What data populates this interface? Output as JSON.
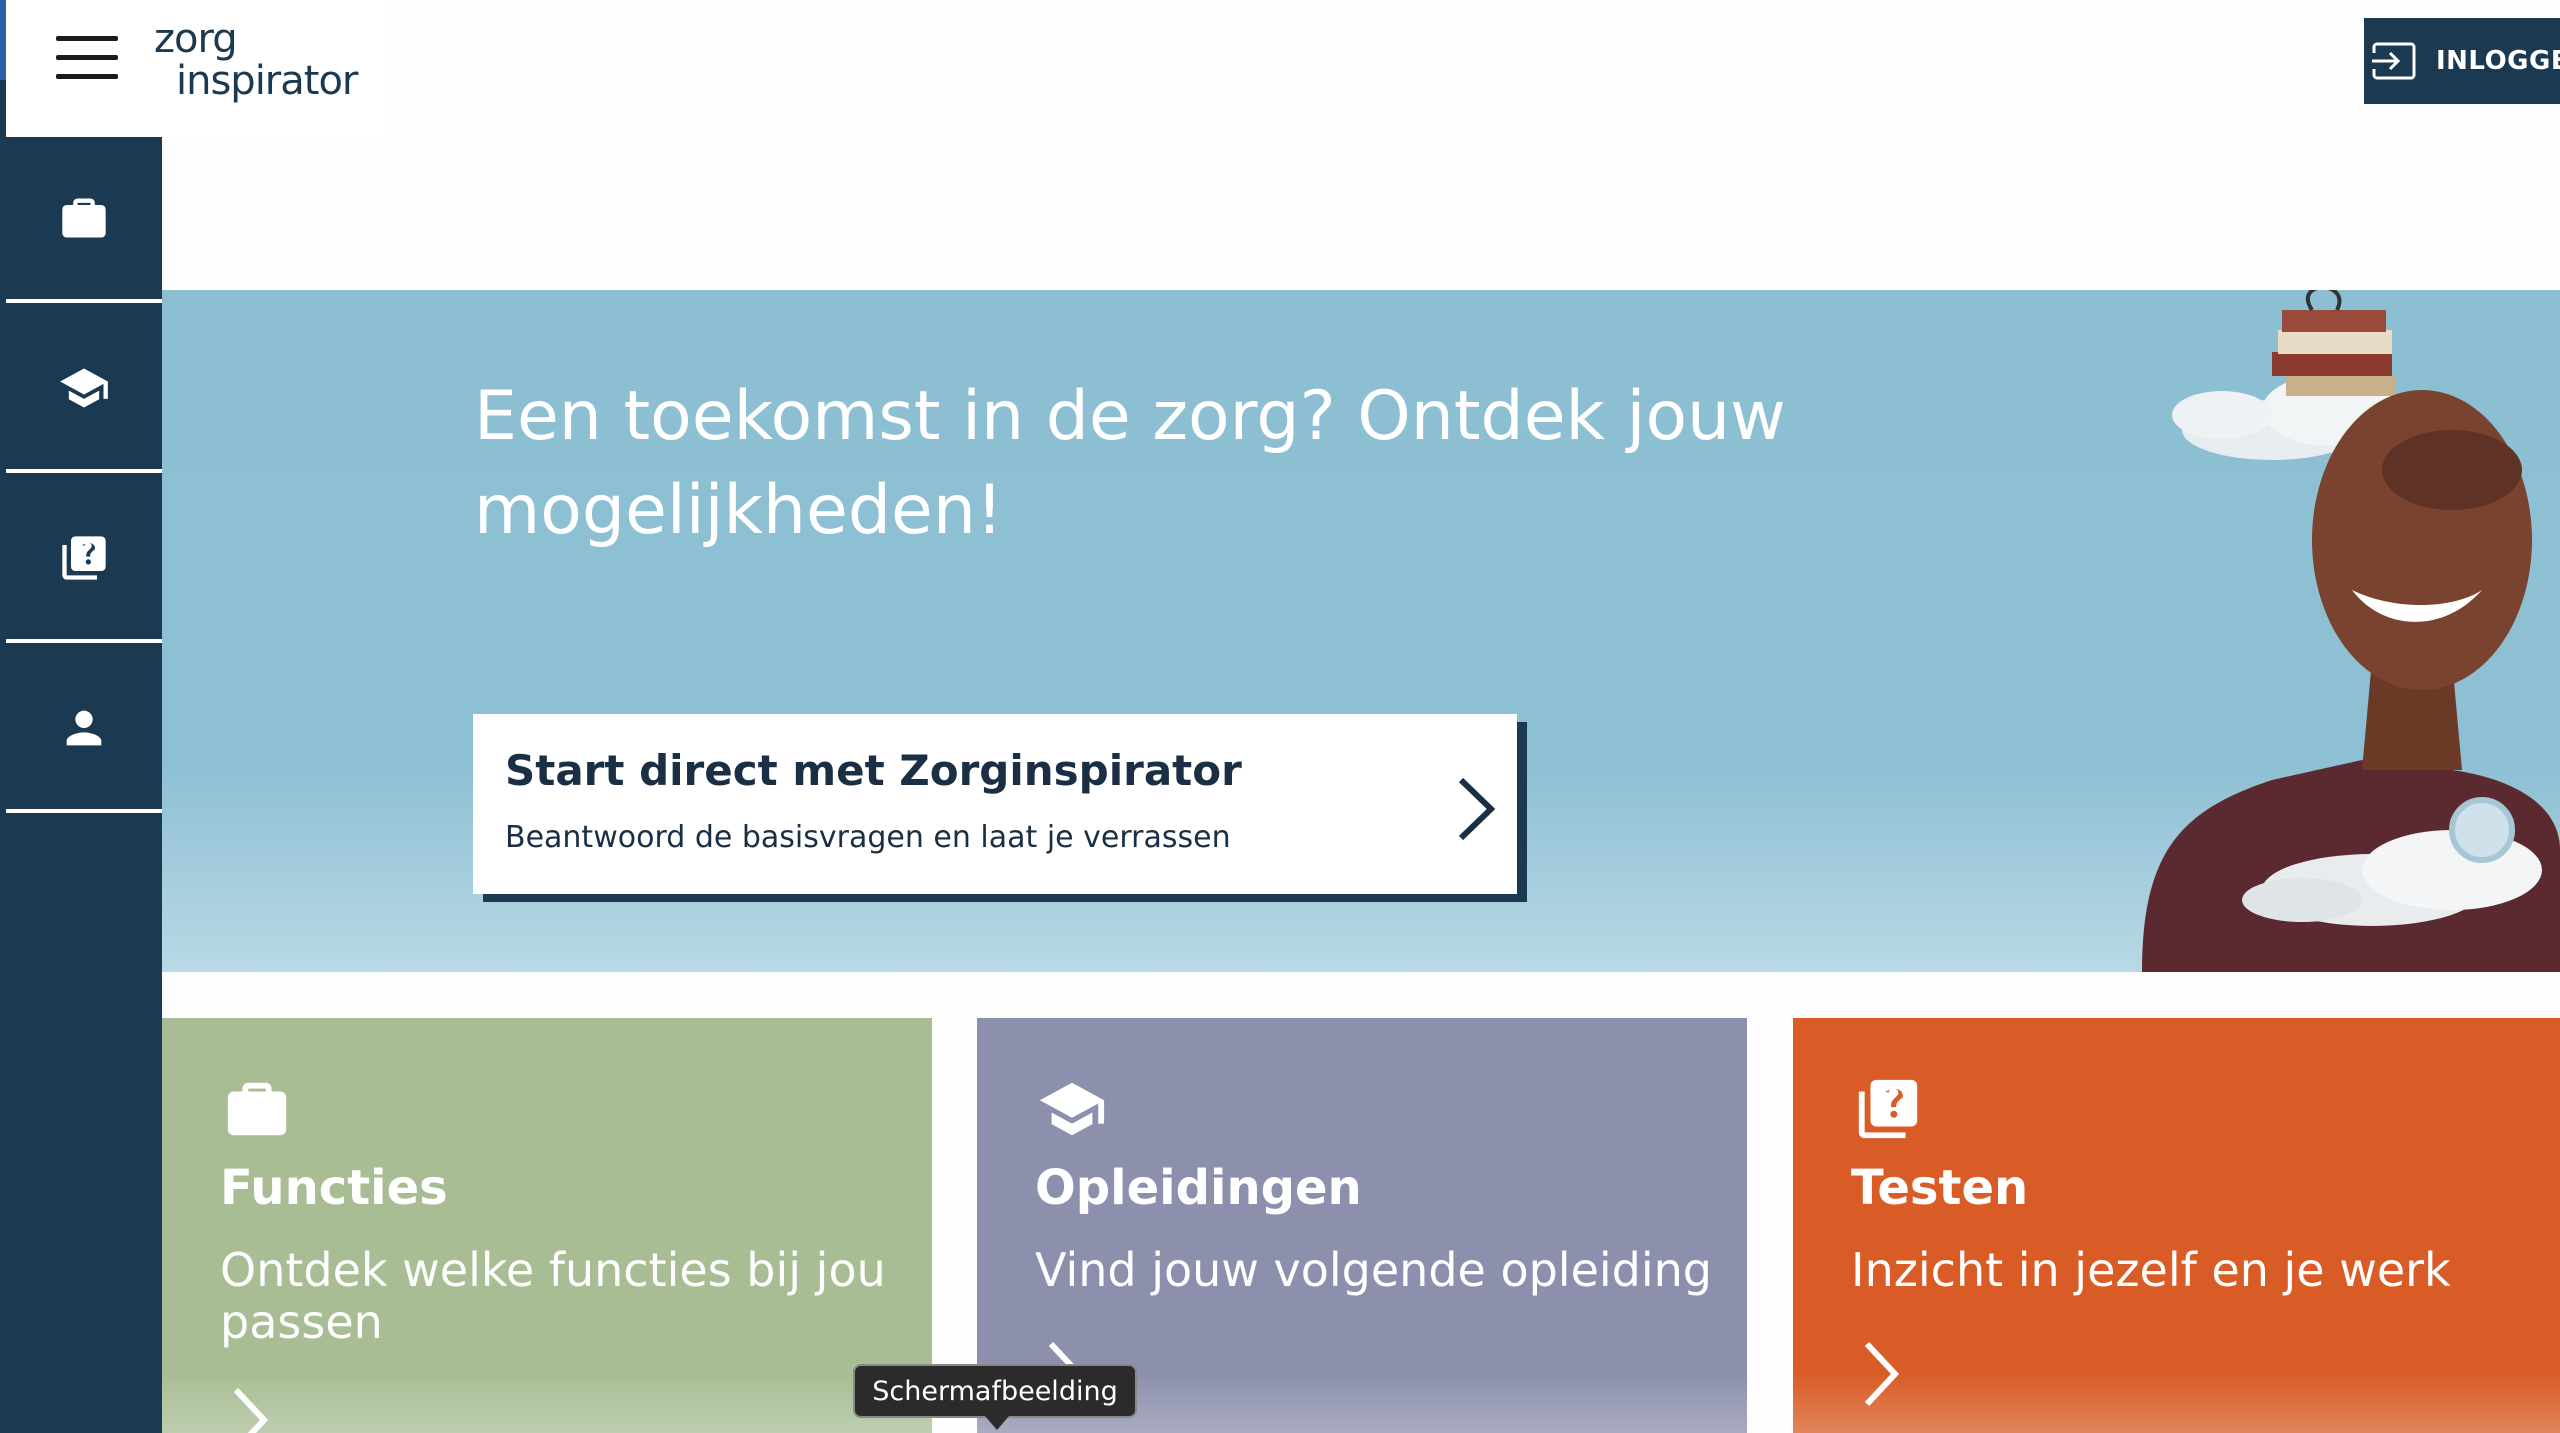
{
  "header": {
    "logo_line1": "zorg",
    "logo_line2": "inspirator",
    "login_label": "INLOGGEN"
  },
  "sidebar": {
    "items": [
      {
        "icon": "briefcase-icon"
      },
      {
        "icon": "graduation-cap-icon"
      },
      {
        "icon": "quiz-icon"
      },
      {
        "icon": "person-icon"
      }
    ]
  },
  "hero": {
    "title": "Een toekomst in de zorg? Ontdek jouw mogelijkheden!",
    "cta_title": "Start direct met Zorginspirator",
    "cta_subtitle": "Beantwoord de basisvragen en laat je verrassen"
  },
  "cards": [
    {
      "title": "Functies",
      "subtitle": "Ontdek welke functies bij jou passen",
      "color": "#a8bd94",
      "icon": "briefcase-icon"
    },
    {
      "title": "Opleidingen",
      "subtitle": "Vind jouw volgende opleiding",
      "color": "#8c90ad",
      "icon": "graduation-cap-icon"
    },
    {
      "title": "Testen",
      "subtitle": "Inzicht in jezelf en je werk",
      "color": "#d95c26",
      "icon": "quiz-icon"
    }
  ],
  "tooltip": {
    "text": "Schermafbeelding"
  },
  "colors": {
    "navy": "#1b3a52",
    "hero_blue": "#8ec0d4"
  }
}
